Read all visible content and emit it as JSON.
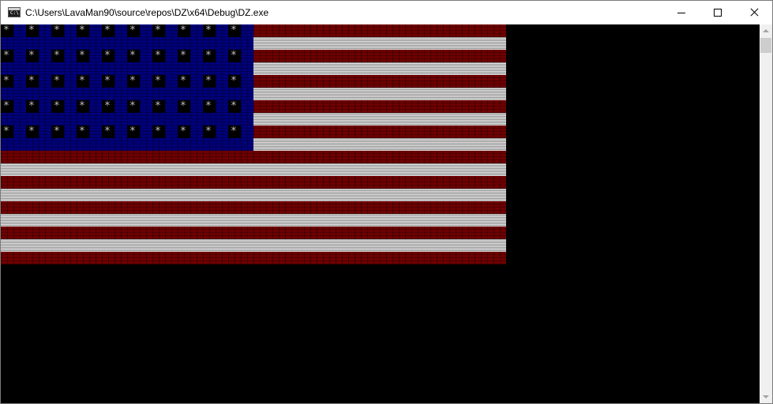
{
  "window": {
    "title": "C:\\Users\\LavaMan90\\source\\repos\\DZ\\x64\\Debug\\DZ.exe",
    "app_icon_text": "C:\\",
    "caption_buttons": [
      "minimize",
      "maximize",
      "close"
    ]
  },
  "flag": {
    "stripe_colors": [
      "red",
      "white",
      "red",
      "white",
      "red",
      "white",
      "red",
      "white",
      "red",
      "white",
      "red",
      "white",
      "red",
      "white",
      "red",
      "white",
      "red",
      "white",
      "red"
    ],
    "colors": {
      "red": "#6e0000",
      "white": "#bdbdbd",
      "canton": "#00007a",
      "star_bg": "#000000",
      "star_fg": "#c0c0c0"
    },
    "star_rows": 5,
    "star_cols": 10,
    "star_char": "*"
  }
}
